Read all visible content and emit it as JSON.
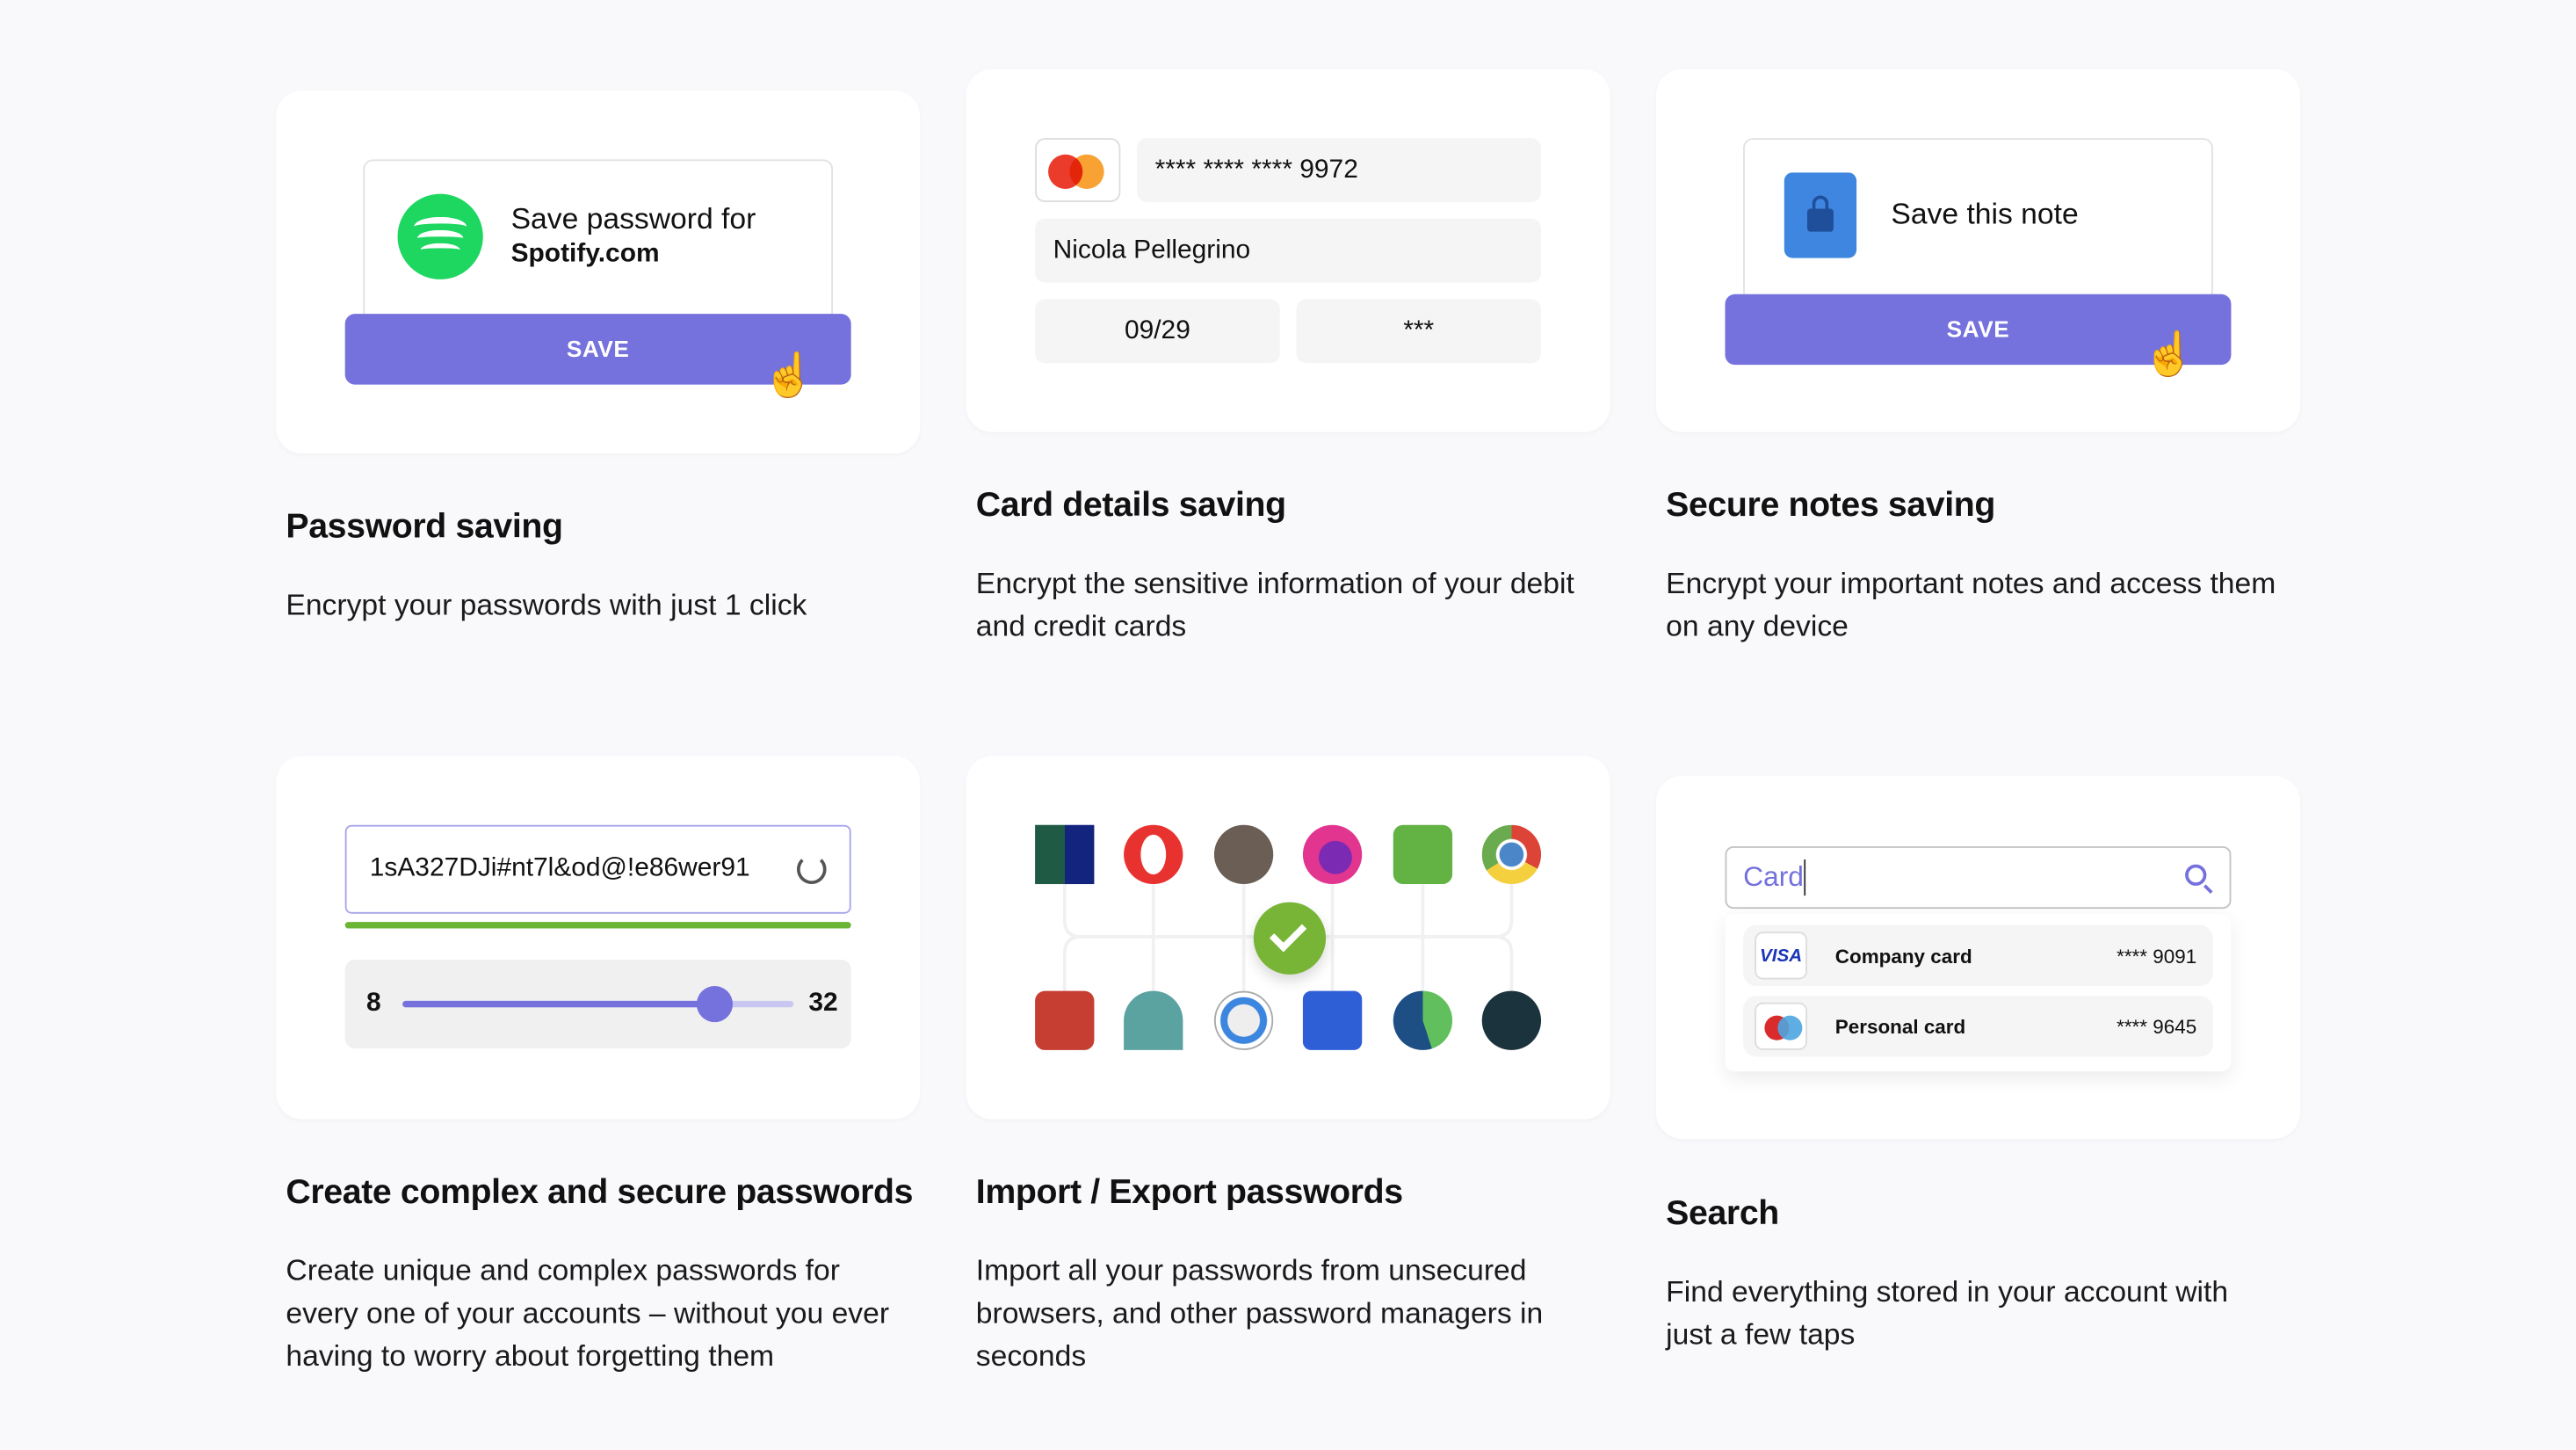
{
  "password_saving": {
    "prompt_line1": "Save password for",
    "prompt_site": "Spotify.com",
    "save_label": "SAVE",
    "title": "Password saving",
    "description": "Encrypt your passwords with just 1 click"
  },
  "card_saving": {
    "card_number": "**** **** **** 9972",
    "holder": "Nicola Pellegrino",
    "expiry": "09/29",
    "cvv": "***",
    "title": "Card details saving",
    "description": "Encrypt the sensitive information of your debit and credit cards"
  },
  "notes_saving": {
    "prompt": "Save this note",
    "save_label": "SAVE",
    "title": "Secure notes saving",
    "description": "Encrypt your important notes and access them on any device"
  },
  "generator": {
    "password": "1sA327DJi#nt7l&od@!e86wer91",
    "min": "8",
    "max": "32",
    "length_fraction": 0.8,
    "strength_color": "#6bb536",
    "title": "Create complex and secure passwords",
    "description": "Create unique and complex passwords for every one of your accounts – without you ever having to worry about forgetting them"
  },
  "import_export": {
    "icons_top": [
      "dashlane-icon",
      "opera-icon",
      "remembear-icon",
      "firefox-icon",
      "roboform-icon",
      "chrome-icon"
    ],
    "icons_bottom": [
      "lastpass-icon",
      "nordpass-icon",
      "1password-icon",
      "bitwarden-icon",
      "edge-icon",
      "dashlane-d-icon"
    ],
    "title": "Import / Export passwords",
    "description": "Import all your passwords from unsecured browsers, and other password managers in seconds"
  },
  "search": {
    "query": "Card",
    "results": [
      {
        "name": "Company card",
        "number": "**** 9091",
        "brand": "VISA"
      },
      {
        "name": "Personal card",
        "number": "**** 9645"
      }
    ],
    "title": "Search",
    "description": "Find everything stored in your account with just a few taps"
  },
  "colors": {
    "accent": "#7571dd",
    "green": "#78b536"
  }
}
